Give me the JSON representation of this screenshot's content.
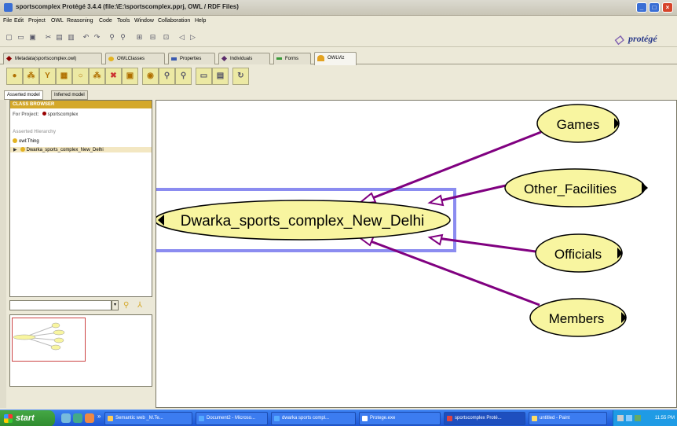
{
  "window": {
    "title": "sportscomplex  Protégé 3.4.4     (file:\\E:\\sportscomplex.pprj, OWL / RDF Files)",
    "controls": [
      "_",
      "□",
      "×"
    ]
  },
  "menu": [
    "File",
    "Edit",
    "Project",
    "OWL",
    "Reasoning",
    "Code",
    "Tools",
    "Window",
    "Collaboration",
    "Help"
  ],
  "logo": {
    "text": "protégé"
  },
  "tabs": [
    {
      "label": "Metadata(sportscomplex.owl)",
      "icon": "metadata-icon",
      "color": "#8b0000"
    },
    {
      "label": "OWLClasses",
      "icon": "class-icon",
      "color": "#e3b322"
    },
    {
      "label": "Properties",
      "icon": "property-icon",
      "color": "#3a5ab0"
    },
    {
      "label": "Individuals",
      "icon": "individual-icon",
      "color": "#5a2a6a"
    },
    {
      "label": "Forms",
      "icon": "forms-icon",
      "color": "#3a9a3a"
    },
    {
      "label": "OWLViz",
      "icon": "owlviz-icon",
      "color": "#e3a322"
    }
  ],
  "subtabs": [
    "Asserted model",
    "Inferred model"
  ],
  "class_browser": {
    "header": "CLASS BROWSER",
    "for_project_label": "For Project:",
    "project_name": "sportscomplex",
    "hierarchy_title": "Asserted Hierarchy",
    "tree": [
      "owl:Thing",
      "Dwarka_sports_complex_New_Delhi"
    ]
  },
  "graph": {
    "center_node": "Dwarka_sports_complex_New_Delhi",
    "nodes": [
      "Games",
      "Other_Facilities",
      "Officials",
      "Members"
    ],
    "node_fill": "#f8f5a0",
    "edge_color": "#800080",
    "selection_color": "#8b8cf0"
  },
  "taskbar": {
    "start": "start",
    "tasks": [
      "Semantic web _M.Te...",
      "Document2 - Microso...",
      "dwarka sports compl...",
      "Protege.exe",
      "sportscomplex Proté...",
      "untitled - Paint"
    ],
    "clock": "11:55 PM"
  }
}
